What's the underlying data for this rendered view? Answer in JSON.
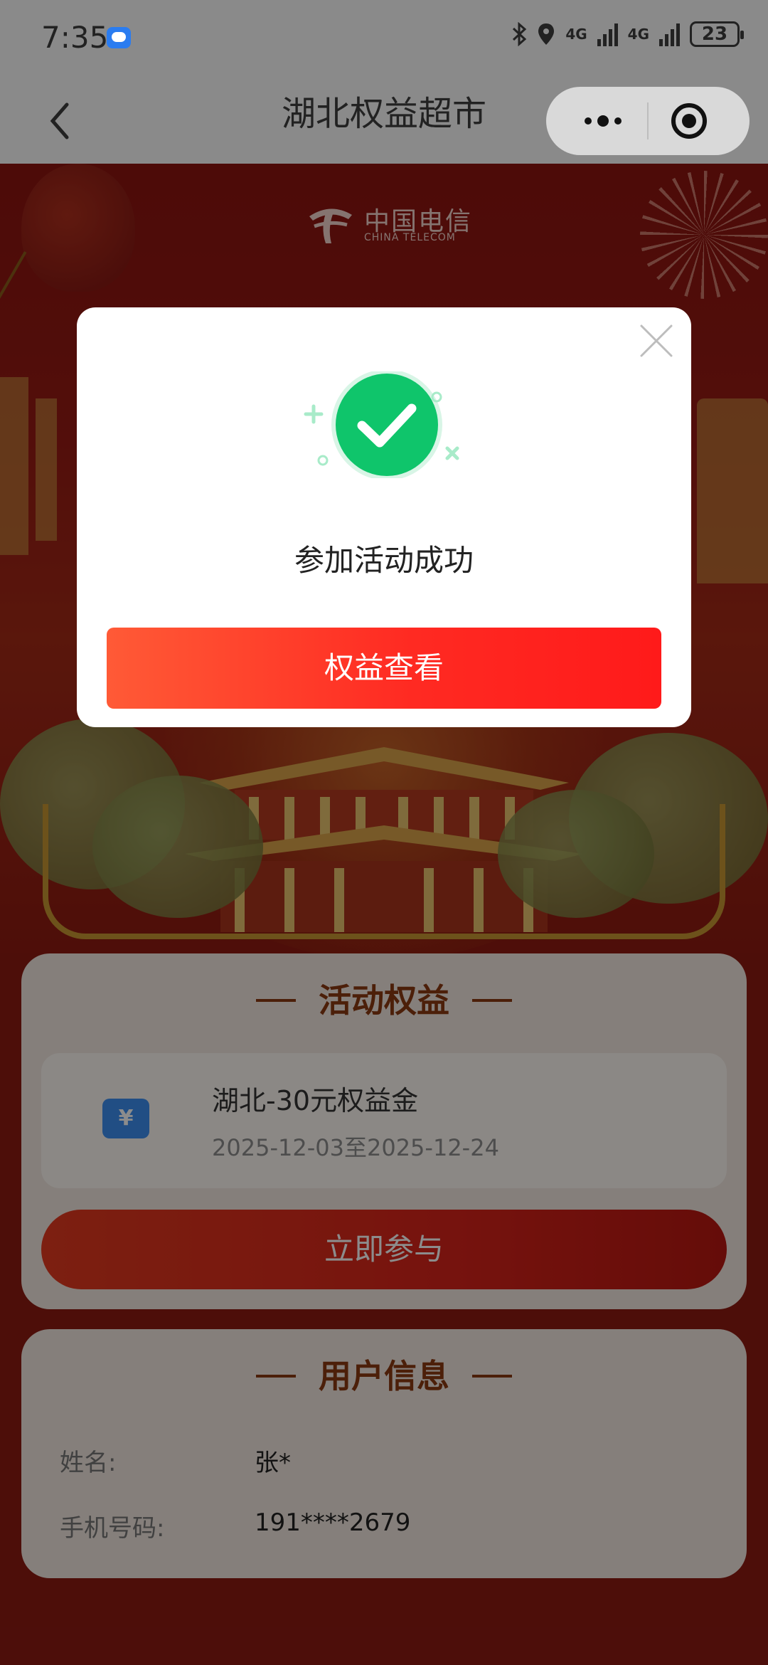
{
  "status_bar": {
    "time": "7:35",
    "network_1": "4G",
    "network_2": "4G",
    "battery": "23"
  },
  "nav": {
    "title": "湖北权益超市",
    "back_icon": "chevron-left-icon",
    "more_icon": "more-dots-icon",
    "close_icon": "target-circle-icon"
  },
  "banner": {
    "logo_cn": "中国电信",
    "logo_en": "CHINA TELECOM"
  },
  "benefits_card": {
    "title": "活动权益",
    "item_name": "湖北-30元权益金",
    "item_date": "2025-12-03至2025-12-24",
    "coupon_symbol": "¥",
    "join_label": "立即参与"
  },
  "user_card": {
    "title": "用户信息",
    "rows": [
      {
        "label": "姓名:",
        "value": "张*"
      },
      {
        "label": "手机号码:",
        "value": "191****2679"
      }
    ]
  },
  "modal": {
    "message": "参加活动成功",
    "button_label": "权益查看",
    "success_icon": "check-circle-icon",
    "close_icon": "close-icon"
  },
  "colors": {
    "accent_red": "#ff2a22",
    "success_green": "#0fc56b",
    "brand_blue": "#3c8ff0"
  }
}
